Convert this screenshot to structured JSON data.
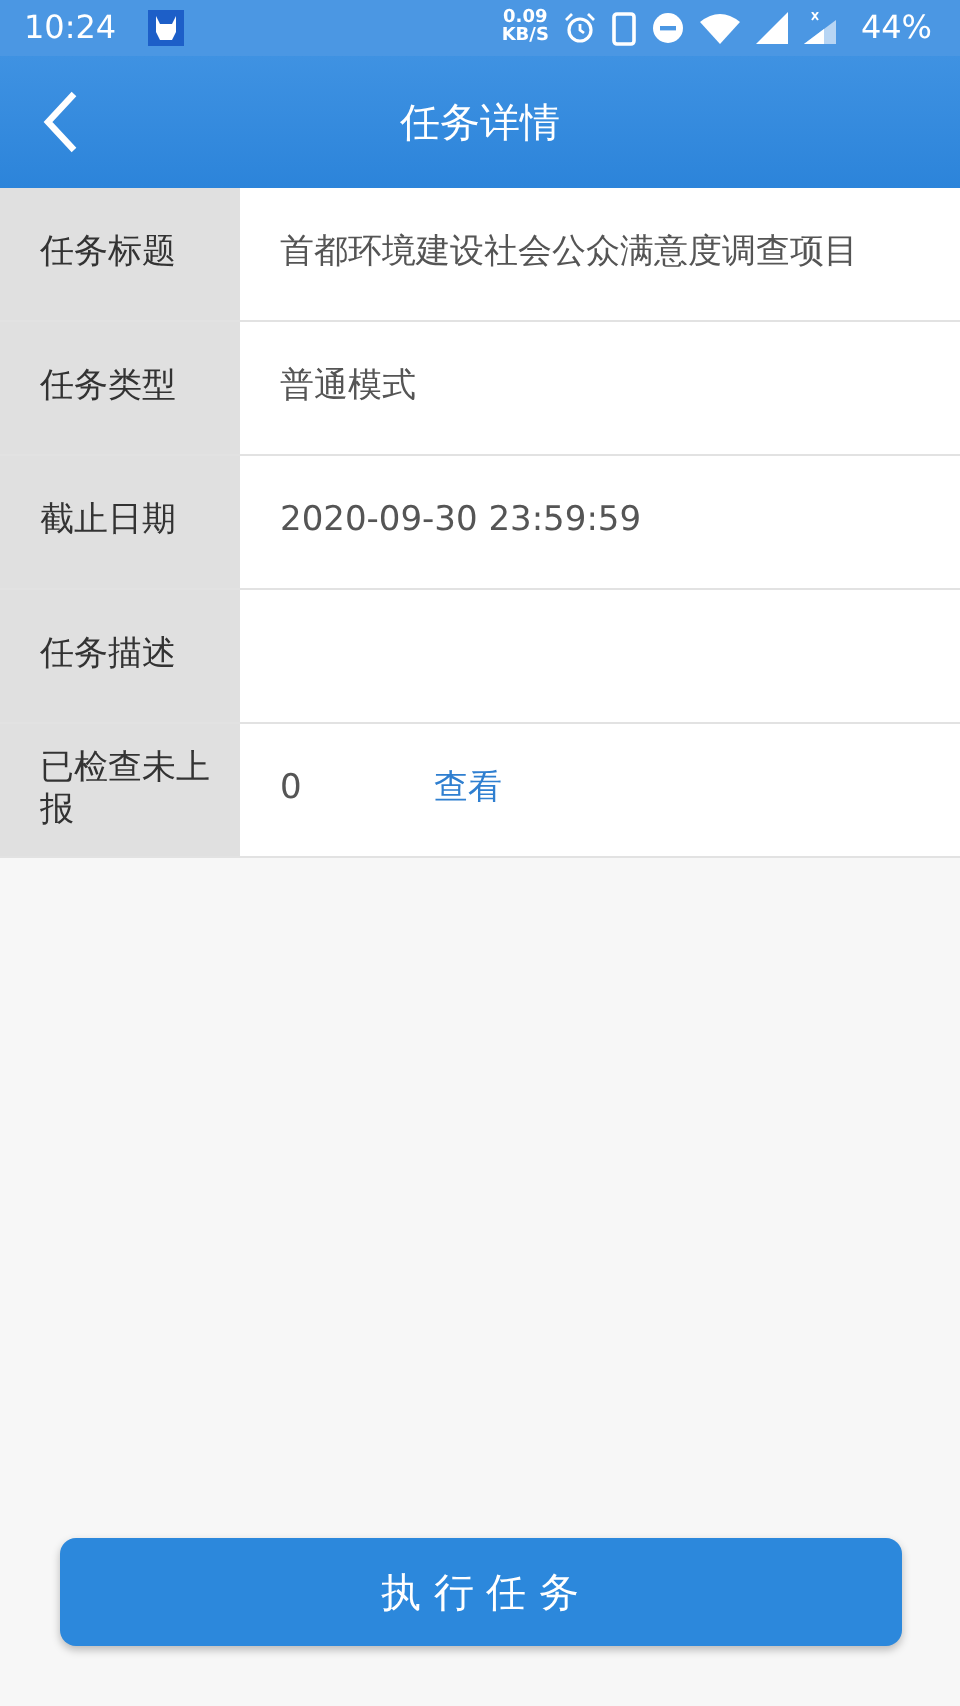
{
  "status_bar": {
    "time": "10:24",
    "net_speed": "0.09",
    "net_unit": "KB/S",
    "battery": "44%"
  },
  "header": {
    "title": "任务详情"
  },
  "fields": [
    {
      "label": "任务标题",
      "value": "首都环境建设社会公众满意度调查项目"
    },
    {
      "label": "任务类型",
      "value": "普通模式"
    },
    {
      "label": "截止日期",
      "value": "2020-09-30 23:59:59"
    },
    {
      "label": "任务描述"
    },
    {
      "label": "已检查未上报",
      "value": "0",
      "link": "查看"
    }
  ],
  "action_button": "执 行 任 务"
}
